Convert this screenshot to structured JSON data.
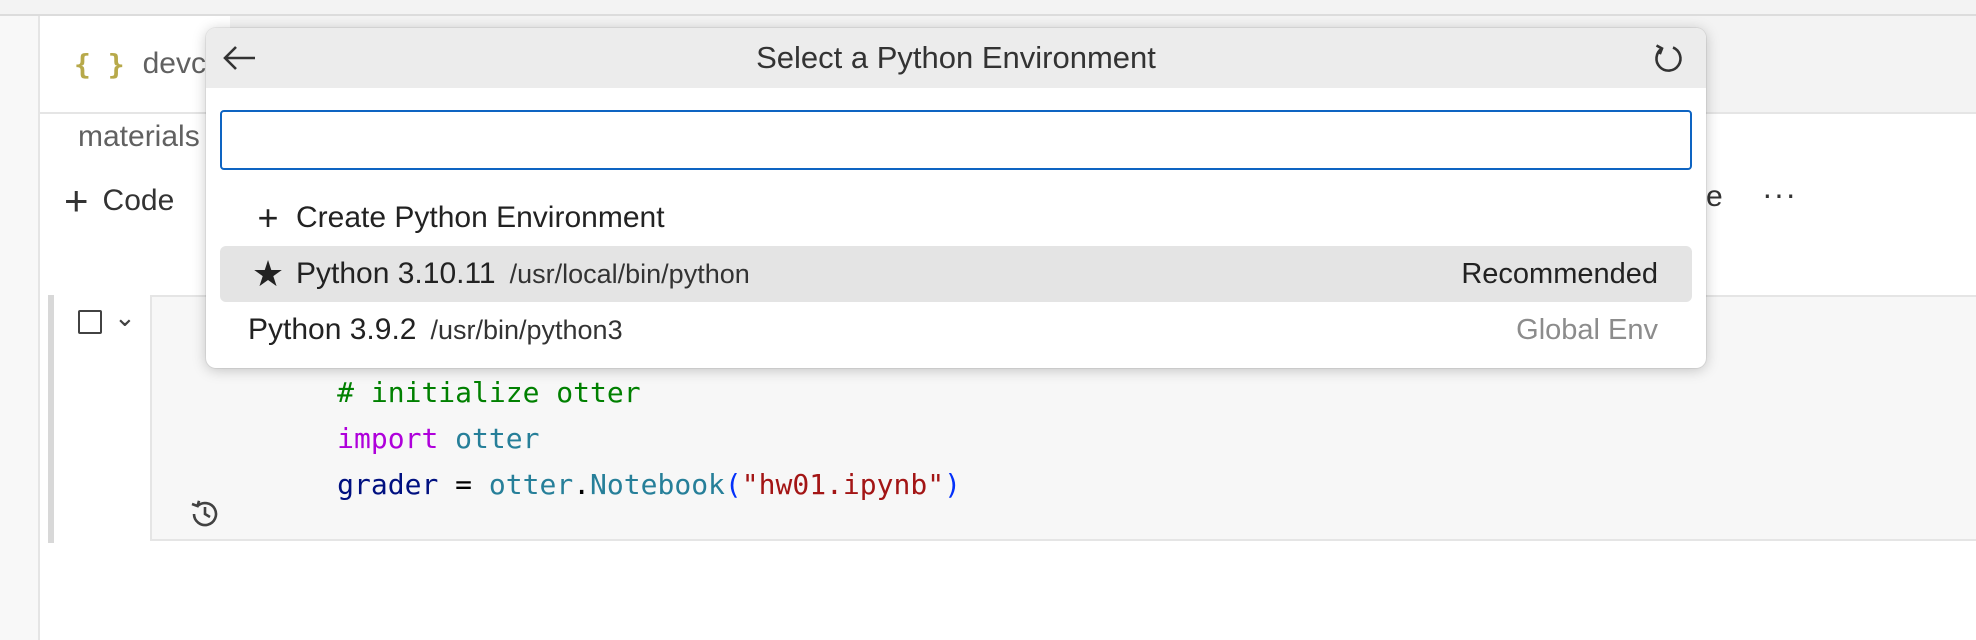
{
  "editor": {
    "tab": {
      "icon": "json-braces-icon",
      "label": "devco"
    },
    "breadcrumb": "materials",
    "toolbar": {
      "add_code_label": "Code",
      "right_fragment": "e",
      "more": "···"
    },
    "cell": {
      "code_lines": [
        {
          "comment": "# initialize otter"
        },
        {
          "keyword": "import",
          "module": "otter"
        },
        {
          "var": "grader",
          "op": " = ",
          "module": "otter",
          "dot": ".",
          "cls": "Notebook",
          "lparen": "(",
          "string": "\"hw01.ipynb\"",
          "rparen": ")"
        }
      ]
    }
  },
  "quick_pick": {
    "title": "Select a Python Environment",
    "back_icon": "arrow-left-icon",
    "refresh_icon": "refresh-icon",
    "input": {
      "value": "",
      "placeholder": ""
    },
    "items": [
      {
        "lead": "+",
        "label": "Create Python Environment",
        "description": "",
        "detail": ""
      },
      {
        "lead": "★",
        "label": "Python 3.10.11",
        "description": "/usr/local/bin/python",
        "detail": "Recommended",
        "selected": true
      },
      {
        "lead": "",
        "label": "Python 3.9.2",
        "description": "/usr/bin/python3",
        "detail": "Global Env"
      }
    ]
  },
  "colors": {
    "accent": "#0e64c2",
    "selected_row": "#e4e4e4",
    "header": "#ececec"
  }
}
